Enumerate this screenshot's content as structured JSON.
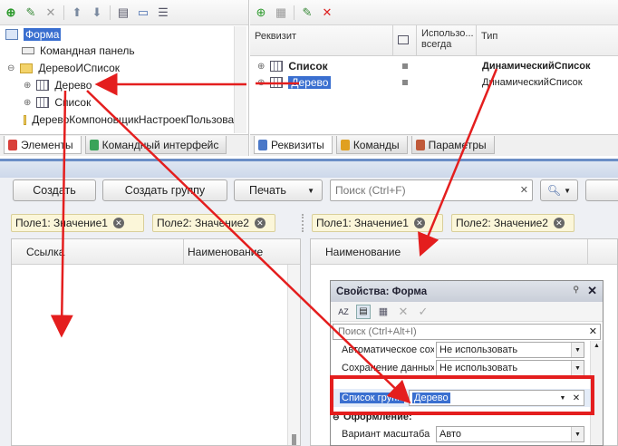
{
  "left_tree": {
    "items": [
      {
        "label": "Форма",
        "selected": true
      },
      {
        "label": "Командная панель"
      },
      {
        "label": "ДеревоИСписок"
      },
      {
        "label": "Дерево"
      },
      {
        "label": "Список"
      },
      {
        "label": "ДеревоКомпоновщикНастроекПользовате"
      }
    ]
  },
  "left_tabs": [
    {
      "label": "Элементы",
      "color": "#d9403a",
      "active": true
    },
    {
      "label": "Командный интерфейс",
      "color": "#3aa35a"
    }
  ],
  "right_grid": {
    "headers": {
      "col1": "Реквизит",
      "col2": "Использо... всегда",
      "col3": "Тип"
    },
    "rows": [
      {
        "name": "Список",
        "type": "ДинамическийСписок",
        "bold": true
      },
      {
        "name": "Дерево",
        "type": "ДинамическийСписок",
        "selected": true
      }
    ]
  },
  "right_tabs": [
    {
      "label": "Реквизиты",
      "color": "#4a78c8",
      "active": true
    },
    {
      "label": "Команды",
      "color": "#e0a020"
    },
    {
      "label": "Параметры",
      "color": "#c05a3a"
    }
  ],
  "form": {
    "buttons": {
      "create": "Создать",
      "create_group": "Создать группу",
      "print": "Печать"
    },
    "search_placeholder": "Поиск (Ctrl+F)",
    "filters_left": [
      "Поле1: Значение1",
      "Поле2: Значение2"
    ],
    "filters_right": [
      "Поле1: Значение1",
      "Поле2: Значение2"
    ],
    "left_list_headers": [
      "Ссылка",
      "Наименование"
    ],
    "right_list_header": "Наименование"
  },
  "properties": {
    "title": "Свойства: Форма",
    "search_placeholder": "Поиск (Ctrl+Alt+I)",
    "rows": [
      {
        "label": "Автоматическое сох",
        "value": "Не использовать"
      },
      {
        "label": "Сохранение данных",
        "value": "Не использовать"
      }
    ],
    "highlight": {
      "label": "Список групп",
      "value": "Дерево"
    },
    "section": "Оформление:",
    "scale_row": {
      "label": "Вариант масштаба",
      "value": "Авто"
    }
  },
  "colors": {
    "accent": "#6b8ec6",
    "arrow": "#e41e1e",
    "highlight_box": "#e41e1e",
    "selection": "#3a6fd0"
  }
}
